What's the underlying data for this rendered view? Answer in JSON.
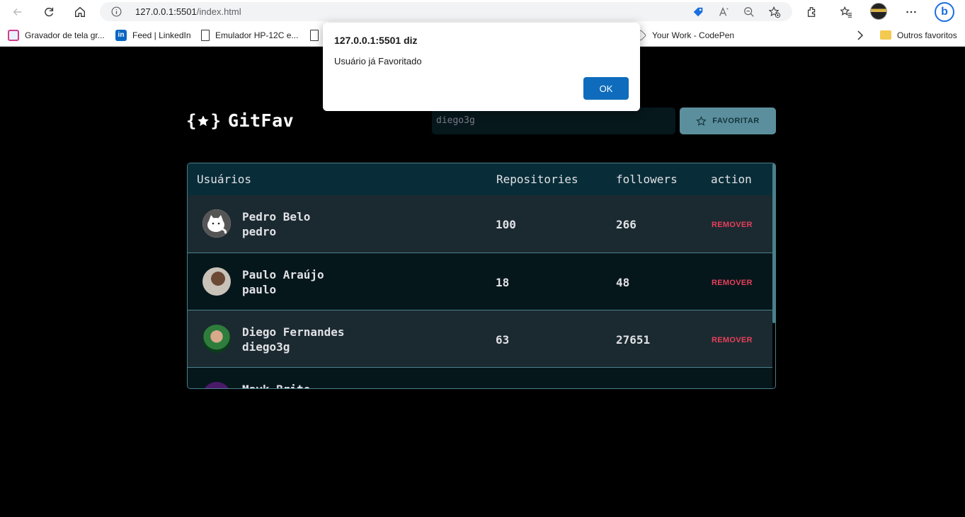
{
  "browser": {
    "url_host": "127.0.0.1",
    "url_port": ":5501",
    "url_path": "/index.html",
    "bookmarks": [
      {
        "label": "Gravador de tela gr...",
        "icon": "screen-recorder-icon"
      },
      {
        "label": "Feed | LinkedIn",
        "icon": "linkedin-icon"
      },
      {
        "label": "Emulador HP-12C e...",
        "icon": "page-icon"
      },
      {
        "label": "Your Work - CodePen",
        "icon": "codepen-icon"
      }
    ],
    "other_favorites": "Outros favoritos"
  },
  "app": {
    "logo_text": "GitFav",
    "search_value": "diego3g",
    "favorite_button": "FAVORITAR",
    "accent": "#5c8f9d",
    "danger": "#e83f5b"
  },
  "table": {
    "headers": [
      "Usuários",
      "Repositories",
      "followers",
      "action"
    ],
    "rows": [
      {
        "name": "Pedro Belo",
        "login": "pedro",
        "repositories": "100",
        "followers": "266",
        "action": "REMOVER"
      },
      {
        "name": "Paulo Araújo",
        "login": "paulo",
        "repositories": "18",
        "followers": "48",
        "action": "REMOVER"
      },
      {
        "name": "Diego Fernandes",
        "login": "diego3g",
        "repositories": "63",
        "followers": "27651",
        "action": "REMOVER"
      },
      {
        "name": "Mayk Brito",
        "login": "",
        "repositories": "",
        "followers": "",
        "action": ""
      }
    ]
  },
  "dialog": {
    "title": "127.0.0.1:5501 diz",
    "message": "Usuário já Favoritado",
    "ok": "OK"
  }
}
